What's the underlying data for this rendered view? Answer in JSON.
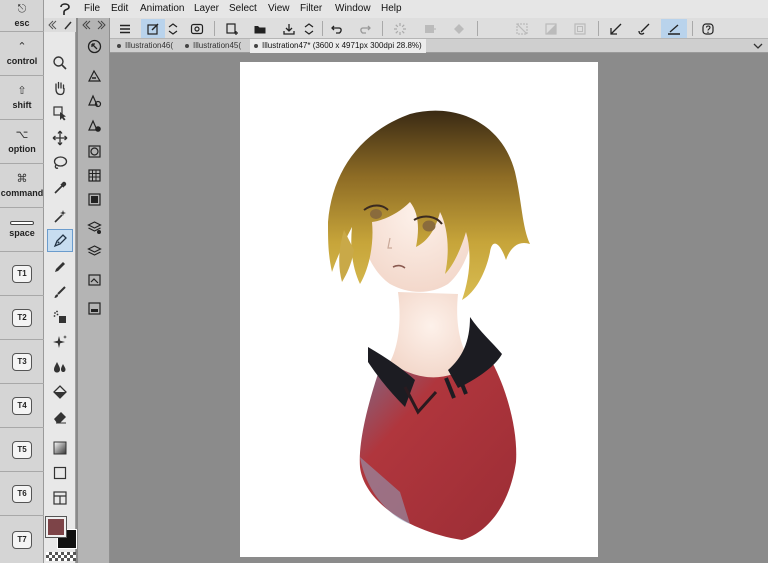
{
  "menu": {
    "items": [
      "File",
      "Edit",
      "Animation",
      "Layer",
      "Select",
      "View",
      "Filter",
      "Window",
      "Help"
    ]
  },
  "modifier_keys": [
    {
      "label": "esc",
      "icon": "esc-icon"
    },
    {
      "label": "control",
      "icon": "chevron-up-icon"
    },
    {
      "label": "shift",
      "icon": "shift-arrow-icon"
    },
    {
      "label": "option",
      "icon": "option-icon"
    },
    {
      "label": "command",
      "icon": "command-icon"
    },
    {
      "label": "space",
      "icon": "space-bar-icon"
    }
  ],
  "shortcut_keys": [
    "T1",
    "T2",
    "T3",
    "T4",
    "T5",
    "T6",
    "T7"
  ],
  "tabs": [
    {
      "label": "Illustration46(",
      "active": false
    },
    {
      "label": "Illustration45(",
      "active": false
    },
    {
      "label": "Illustration47* (3600 x 4971px 300dpi 28.8%)",
      "active": true
    }
  ],
  "colors": {
    "main": "#7d4448",
    "sub": "#111111",
    "accent": "#6b9ccd"
  },
  "artwork": {
    "hair": "#b8942f",
    "hair_dark": "#3a2a14",
    "skin": "#fbe9df",
    "jacket": "#b0363d",
    "collar": "#1c1c22"
  }
}
